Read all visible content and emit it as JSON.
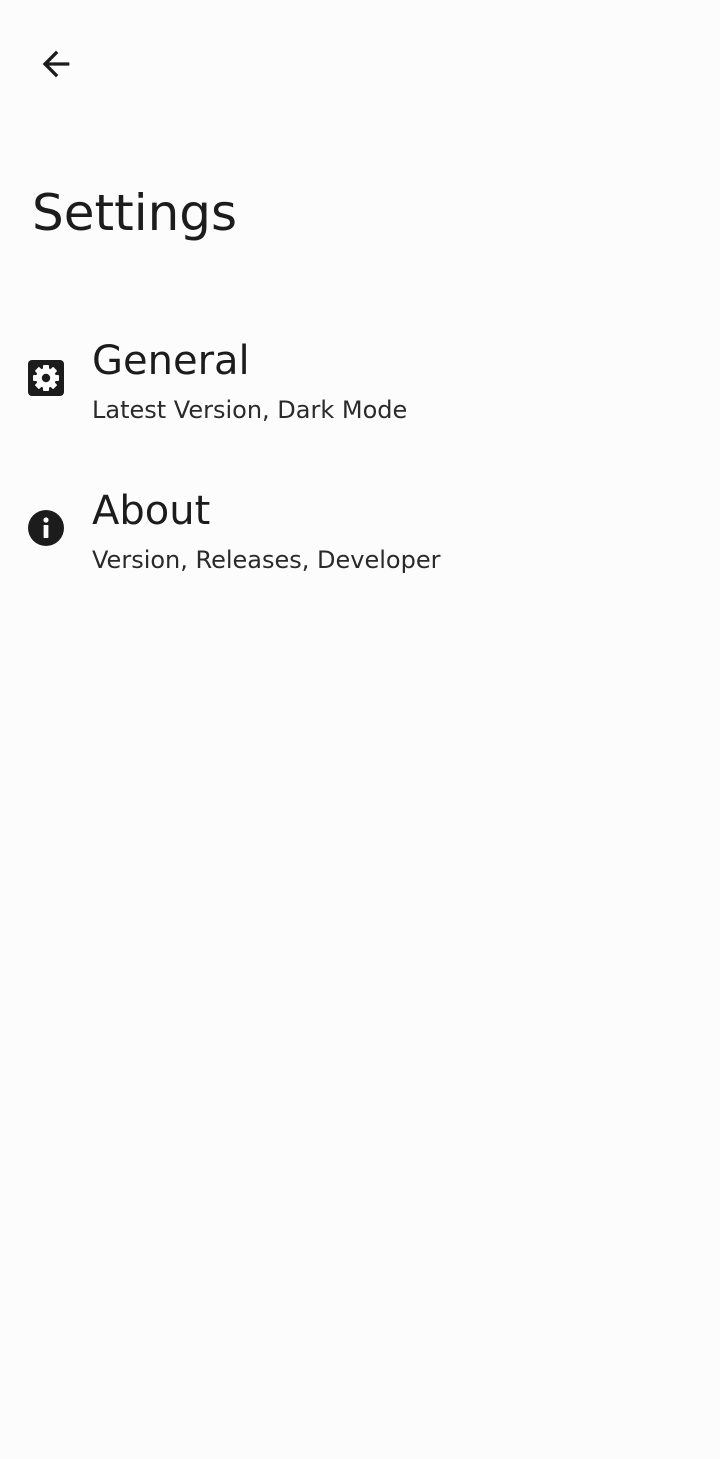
{
  "header": {
    "back_icon": "arrow-back-icon",
    "title": "Settings"
  },
  "settings": {
    "items": [
      {
        "icon": "gear-icon",
        "title": "General",
        "subtitle": "Latest Version, Dark Mode"
      },
      {
        "icon": "info-icon",
        "title": "About",
        "subtitle": "Version, Releases, Developer"
      }
    ]
  },
  "colors": {
    "background": "#fcfcfc",
    "text": "#1c1c1c",
    "icon": "#1c1c1c"
  }
}
